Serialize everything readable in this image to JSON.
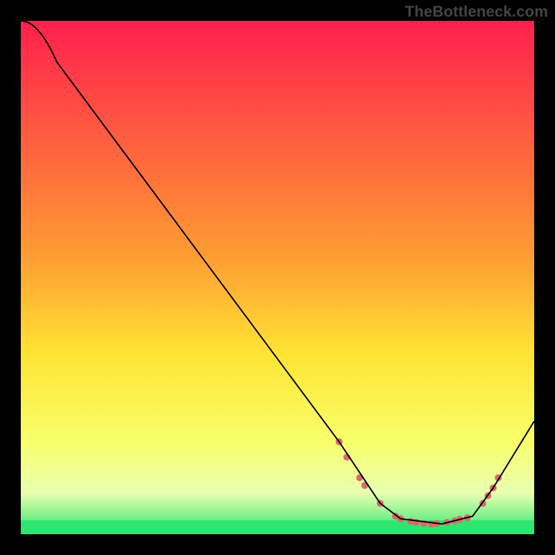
{
  "watermark": "TheBottleneck.com",
  "chart_data": {
    "type": "line",
    "title": "",
    "xlabel": "",
    "ylabel": "",
    "xlim": [
      0,
      100
    ],
    "ylim": [
      0,
      100
    ],
    "grid": false,
    "legend": false,
    "background_gradient": {
      "stops": [
        {
          "offset": 0,
          "color": "#ff1f4d"
        },
        {
          "offset": 45,
          "color": "#ff9a33"
        },
        {
          "offset": 65,
          "color": "#ffe433"
        },
        {
          "offset": 82,
          "color": "#f8ff6a"
        },
        {
          "offset": 92,
          "color": "#e8ffb0"
        },
        {
          "offset": 100,
          "color": "#2ee66f"
        }
      ]
    },
    "curve": [
      {
        "x": 0,
        "y": 100
      },
      {
        "x": 7,
        "y": 92
      },
      {
        "x": 62,
        "y": 18
      },
      {
        "x": 70,
        "y": 6
      },
      {
        "x": 74,
        "y": 3
      },
      {
        "x": 82,
        "y": 2
      },
      {
        "x": 88,
        "y": 3.5
      },
      {
        "x": 92,
        "y": 9
      },
      {
        "x": 100,
        "y": 22
      }
    ],
    "marker_points": [
      {
        "x": 62,
        "y": 18
      },
      {
        "x": 63.5,
        "y": 15
      },
      {
        "x": 66,
        "y": 11
      },
      {
        "x": 67,
        "y": 9.5
      },
      {
        "x": 70,
        "y": 6
      },
      {
        "x": 73,
        "y": 3.5
      },
      {
        "x": 74,
        "y": 3
      },
      {
        "x": 76,
        "y": 2.5
      },
      {
        "x": 77,
        "y": 2.3
      },
      {
        "x": 78.5,
        "y": 2.1
      },
      {
        "x": 80,
        "y": 2
      },
      {
        "x": 81,
        "y": 2.1
      },
      {
        "x": 83,
        "y": 2.3
      },
      {
        "x": 84.5,
        "y": 2.6
      },
      {
        "x": 85.5,
        "y": 2.9
      },
      {
        "x": 87,
        "y": 3.2
      },
      {
        "x": 90,
        "y": 6
      },
      {
        "x": 91,
        "y": 7.5
      },
      {
        "x": 92,
        "y": 9
      },
      {
        "x": 93,
        "y": 11
      }
    ]
  }
}
